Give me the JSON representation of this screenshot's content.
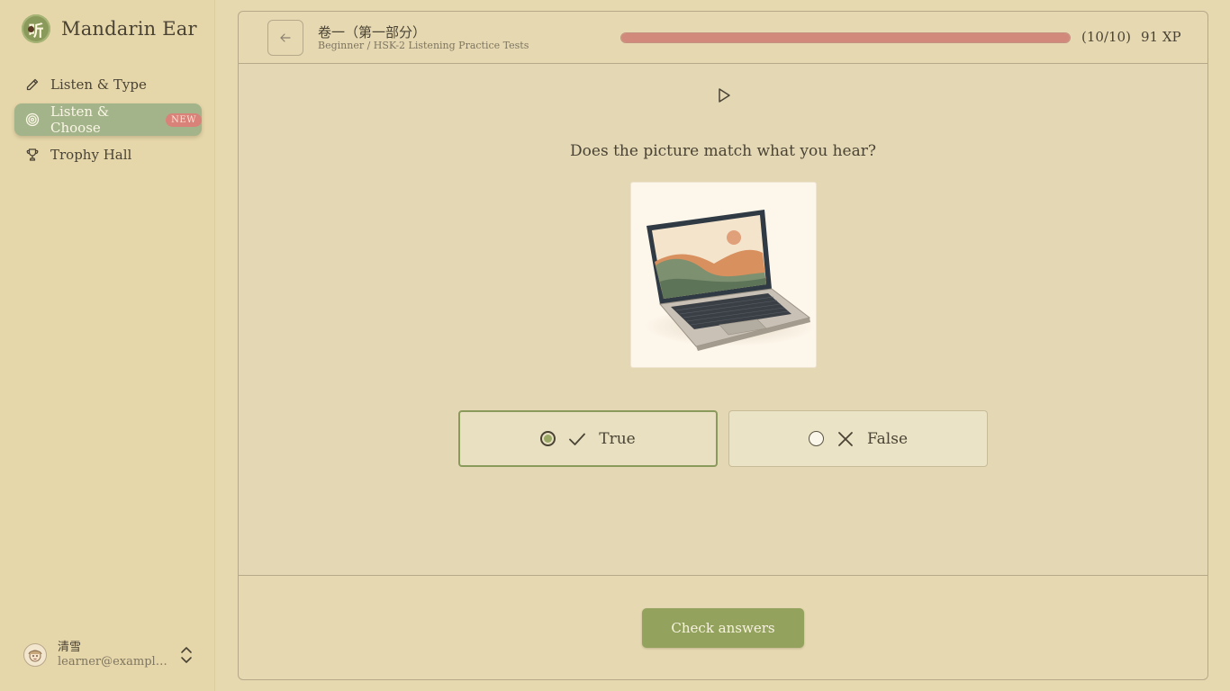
{
  "app": {
    "logo_glyph": "听",
    "name": "Mandarin Ear"
  },
  "sidebar": {
    "items": [
      {
        "label": "Listen & Type",
        "icon": "pencil-icon",
        "active": false
      },
      {
        "label": "Listen & Choose",
        "icon": "target-icon",
        "active": true,
        "badge": "NEW"
      },
      {
        "label": "Trophy Hall",
        "icon": "trophy-icon",
        "active": false
      }
    ]
  },
  "user": {
    "name": "清雪",
    "email": "learner@example...."
  },
  "header": {
    "title": "卷一（第一部分）",
    "breadcrumb": "Beginner / HSK-2 Listening Practice Tests",
    "progress_percent": 100,
    "progress_count": "(10/10)",
    "xp": "91 XP"
  },
  "question": {
    "prompt": "Does the picture match what you hear?",
    "image_icon": "laptop-illustration",
    "options": [
      {
        "label": "True",
        "icon": "check-icon",
        "selected": true
      },
      {
        "label": "False",
        "icon": "x-icon",
        "selected": false
      }
    ]
  },
  "footer": {
    "check_label": "Check answers"
  },
  "colors": {
    "accent": "#93a35d",
    "active_nav": "#a4b48a",
    "progress": "#d0897a",
    "badge": "#d9827a"
  }
}
